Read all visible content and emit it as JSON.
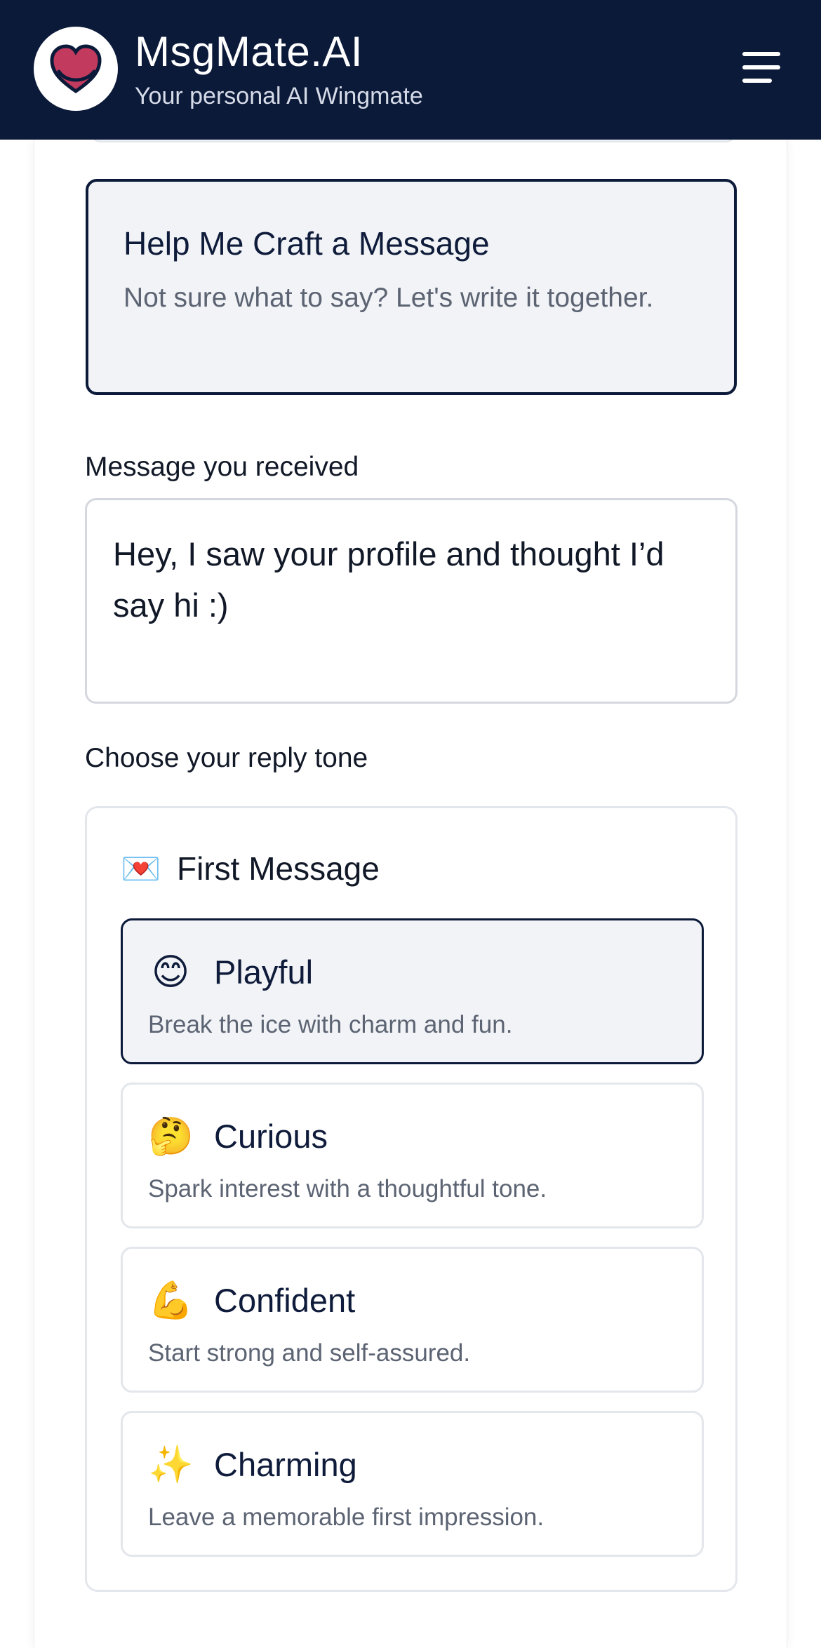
{
  "header": {
    "app_title": "MsgMate.AI",
    "app_subtitle": "Your personal AI Wingmate",
    "logo_icon": "heart-icon",
    "menu_icon": "hamburger-menu-icon",
    "colors": {
      "background": "#0c1a3a",
      "logo_heart": "#c23a5e"
    }
  },
  "craft_card": {
    "title": "Help Me Craft a Message",
    "description": "Not sure what to say? Let's write it together."
  },
  "received": {
    "label": "Message you received",
    "value": "Hey, I saw your profile and thought I’d say hi :)"
  },
  "tone": {
    "label": "Choose your reply tone",
    "group": {
      "emoji": "💌",
      "title": "First Message",
      "options": [
        {
          "emoji": "😊",
          "name": "Playful",
          "description": "Break the ice with charm and fun.",
          "selected": true
        },
        {
          "emoji": "🤔",
          "name": "Curious",
          "description": "Spark interest with a thoughtful tone.",
          "selected": false
        },
        {
          "emoji": "💪",
          "name": "Confident",
          "description": "Start strong and self-assured.",
          "selected": false
        },
        {
          "emoji": "✨",
          "name": "Charming",
          "description": "Leave a memorable first impression.",
          "selected": false
        }
      ]
    }
  }
}
